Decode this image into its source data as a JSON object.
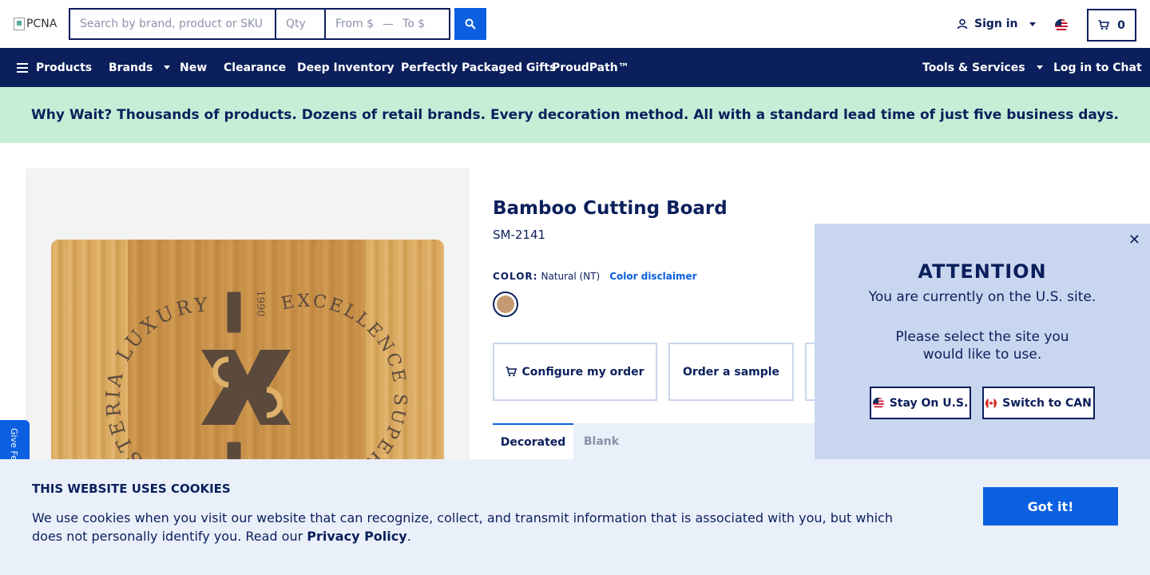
{
  "header": {
    "logo_alt": "PCNA",
    "search_placeholder": "Search by brand, product or SKU",
    "qty_placeholder": "Qty",
    "price_from_placeholder": "From $",
    "price_to_placeholder": "To $",
    "signin_label": "Sign in",
    "cart_count": "0"
  },
  "nav": {
    "products": "Products",
    "brands": "Brands",
    "new": "New",
    "clearance": "Clearance",
    "deep_inventory": "Deep Inventory",
    "gifts": "Perfectly Packaged Gifts",
    "proudpath": "ProudPath™",
    "tools": "Tools & Services",
    "chat": "Log in to Chat"
  },
  "banner": {
    "text": "Why Wait? Thousands of products. Dozens of retail brands. Every decoration method. All with a standard lead time of just five business days."
  },
  "feedback": {
    "label": "Give Feedback"
  },
  "product": {
    "title": "Bamboo Cutting Board",
    "sku": "SM-2141",
    "color_label": "COLOR:",
    "color_value": "Natural (NT)",
    "color_disclaimer": "Color disclaimer",
    "swatch_color": "#c49a72",
    "configure_label": "Configure my order",
    "sample_label": "Order a sample",
    "tabs": [
      {
        "label": "Decorated",
        "active": true
      },
      {
        "label": "Blank",
        "active": false
      }
    ]
  },
  "attention": {
    "title": "ATTENTION",
    "line1": "You are currently on the U.S. site.",
    "line2": "Please select the site you would like to use.",
    "stay_label": "Stay On U.S.",
    "switch_label": "Switch to CAN"
  },
  "cookie": {
    "title": "THIS WEBSITE USES COOKIES",
    "text": "We use cookies when you visit our website that can recognize, collect, and transmit information that is associated with you, but which does not personally identify you. Read our",
    "link": "Privacy Policy",
    "end": ".",
    "button": "Got it!"
  },
  "colors": {
    "navy": "#0b1f5c",
    "blue": "#0b5fe0",
    "banner_green": "#c4efd6",
    "modal_bg": "#c8d6ef"
  }
}
